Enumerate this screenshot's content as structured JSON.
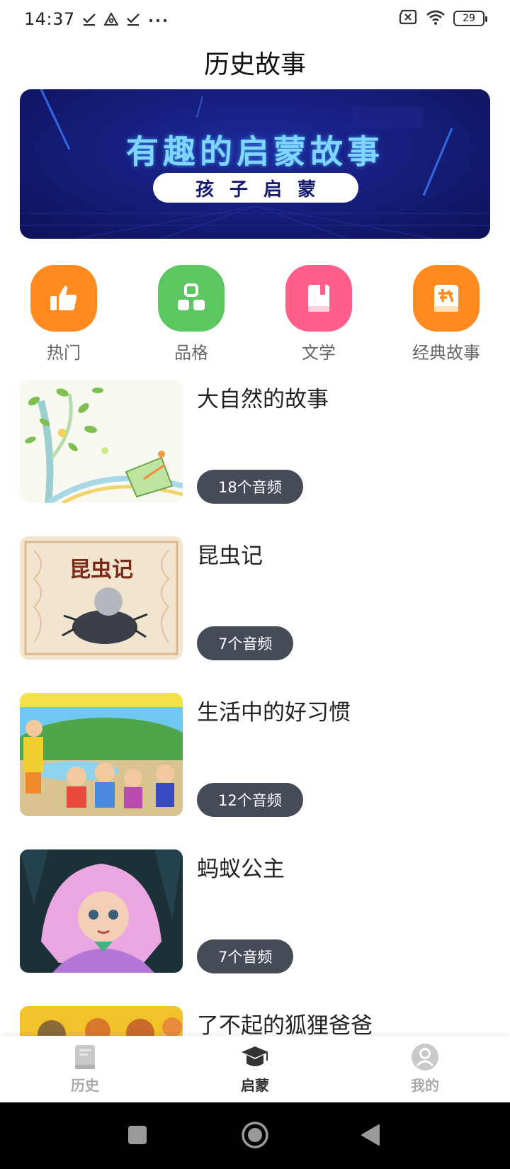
{
  "status_bar": {
    "time": "14:37",
    "left_icons": [
      "download-done-icon",
      "triangle-app-icon",
      "download-done-icon",
      "more-dots-icon"
    ],
    "right_icons": [
      "sim-x-icon",
      "wifi-icon"
    ],
    "battery": "29"
  },
  "page": {
    "title": "历史故事"
  },
  "banner": {
    "headline": "有趣的启蒙故事",
    "pill_text": "孩子启蒙",
    "colors": {
      "background": "#161e7d",
      "headline": "#7fd7ff",
      "pill": "#ffffff"
    }
  },
  "categories": [
    {
      "label": "热门",
      "icon": "thumbs-up-icon",
      "color": "#ff8a1f"
    },
    {
      "label": "品格",
      "icon": "blocks-icon",
      "color": "#5cc660"
    },
    {
      "label": "文学",
      "icon": "book-icon",
      "color": "#ff5f8a"
    },
    {
      "label": "经典故事",
      "icon": "idiom-icon",
      "color": "#ff8a1f"
    }
  ],
  "list": {
    "items": [
      {
        "title": "大自然的故事",
        "badge": "18个音频",
        "thumb": "nature-illustration"
      },
      {
        "title": "昆虫记",
        "badge": "7个音频",
        "thumb": "insect-book-cover"
      },
      {
        "title": "生活中的好习惯",
        "badge": "12个音频",
        "thumb": "children-cartoon"
      },
      {
        "title": "蚂蚁公主",
        "badge": "7个音频",
        "thumb": "ant-princess-cartoon"
      },
      {
        "title": "了不起的狐狸爸爸",
        "badge": "",
        "thumb": "fox-cartoon"
      }
    ],
    "thumb_cover_text": "昆虫记"
  },
  "bottom_nav": {
    "items": [
      {
        "label": "历史",
        "icon": "book-stack-icon",
        "active": false
      },
      {
        "label": "启蒙",
        "icon": "graduation-cap-icon",
        "active": true
      },
      {
        "label": "我的",
        "icon": "profile-icon",
        "active": false
      }
    ]
  },
  "system_nav": [
    "recent-apps-icon",
    "home-icon",
    "back-icon"
  ]
}
